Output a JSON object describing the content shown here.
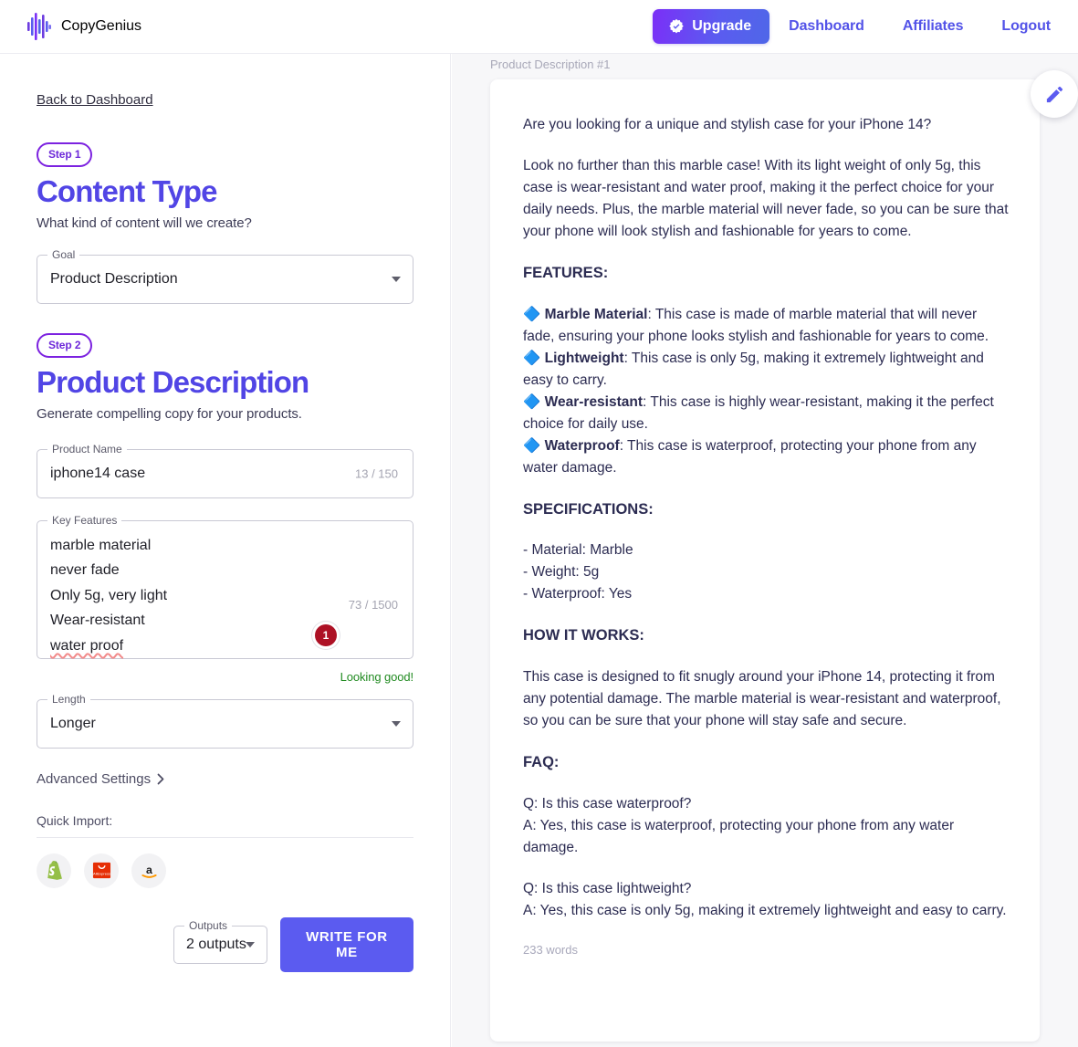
{
  "header": {
    "brand": "CopyGenius",
    "upgrade_label": "Upgrade",
    "nav": [
      {
        "label": "Dashboard"
      },
      {
        "label": "Affiliates"
      },
      {
        "label": "Logout"
      }
    ]
  },
  "sidebar": {
    "back_link": "Back to Dashboard",
    "step1": {
      "badge": "Step 1",
      "title": "Content Type",
      "subtitle": "What kind of content will we create?",
      "goal_field": {
        "legend": "Goal",
        "value": "Product Description"
      }
    },
    "step2": {
      "badge": "Step 2",
      "title": "Product Description",
      "subtitle": "Generate compelling copy for your products.",
      "product_name": {
        "legend": "Product Name",
        "value": "iphone14 case",
        "counter": "13 / 150"
      },
      "key_features": {
        "legend": "Key Features",
        "lines": [
          "marble material",
          "never fade",
          "Only 5g, very light",
          "Wear-resistant"
        ],
        "misspelled_line": "water proof",
        "counter": "73 / 1500",
        "error_count": "1",
        "hint": "Looking good!"
      },
      "length": {
        "legend": "Length",
        "value": "Longer"
      },
      "advanced_settings": "Advanced Settings",
      "quick_import_label": "Quick Import:",
      "quick_import": [
        {
          "name": "shopify"
        },
        {
          "name": "aliexpress"
        },
        {
          "name": "amazon"
        }
      ],
      "outputs": {
        "legend": "Outputs",
        "value": "2 outputs"
      },
      "write_button": "WRITE FOR ME"
    }
  },
  "output": {
    "label": "Product Description #1",
    "wordcount": "233 words",
    "intro": "Are you looking for a unique and stylish case for your iPhone 14?",
    "para2": "Look no further than this marble case! With its light weight of only 5g, this case is wear-resistant and water proof, making it the perfect choice for your daily needs. Plus, the marble material will never fade, so you can be sure that your phone will look stylish and fashionable for years to come.",
    "features_heading": "FEATURES:",
    "features": [
      {
        "title": "Marble Material",
        "text": ": This case is made of marble material that will never fade, ensuring your phone looks stylish and fashionable for years to come."
      },
      {
        "title": "Lightweight",
        "text": ": This case is only 5g, making it extremely lightweight and easy to carry."
      },
      {
        "title": "Wear-resistant",
        "text": ": This case is highly wear-resistant, making it the perfect choice for daily use."
      },
      {
        "title": "Waterproof",
        "text": ": This case is waterproof, protecting your phone from any water damage."
      }
    ],
    "specs_heading": "SPECIFICATIONS:",
    "specs": [
      "- Material: Marble",
      "- Weight: 5g",
      "- Waterproof: Yes"
    ],
    "how_heading": "HOW IT WORKS:",
    "how_text": "This case is designed to fit snugly around your iPhone 14, protecting it from any potential damage. The marble material is wear-resistant and waterproof, so you can be sure that your phone will stay safe and secure.",
    "faq_heading": "FAQ:",
    "faq": [
      {
        "q": "Q: Is this case waterproof?",
        "a": "A: Yes, this case is waterproof, protecting your phone from any water damage."
      },
      {
        "q": "Q: Is this case lightweight?",
        "a": "A: Yes, this case is only 5g, making it extremely lightweight and easy to carry."
      }
    ]
  },
  "colors": {
    "brand_purple": "#5145e5",
    "accent_blue": "#5b5bf0",
    "step_badge": "#6d28d9",
    "success_green": "#228b22",
    "error_red": "#ad1125",
    "diamond_blue": "#2075d6"
  }
}
